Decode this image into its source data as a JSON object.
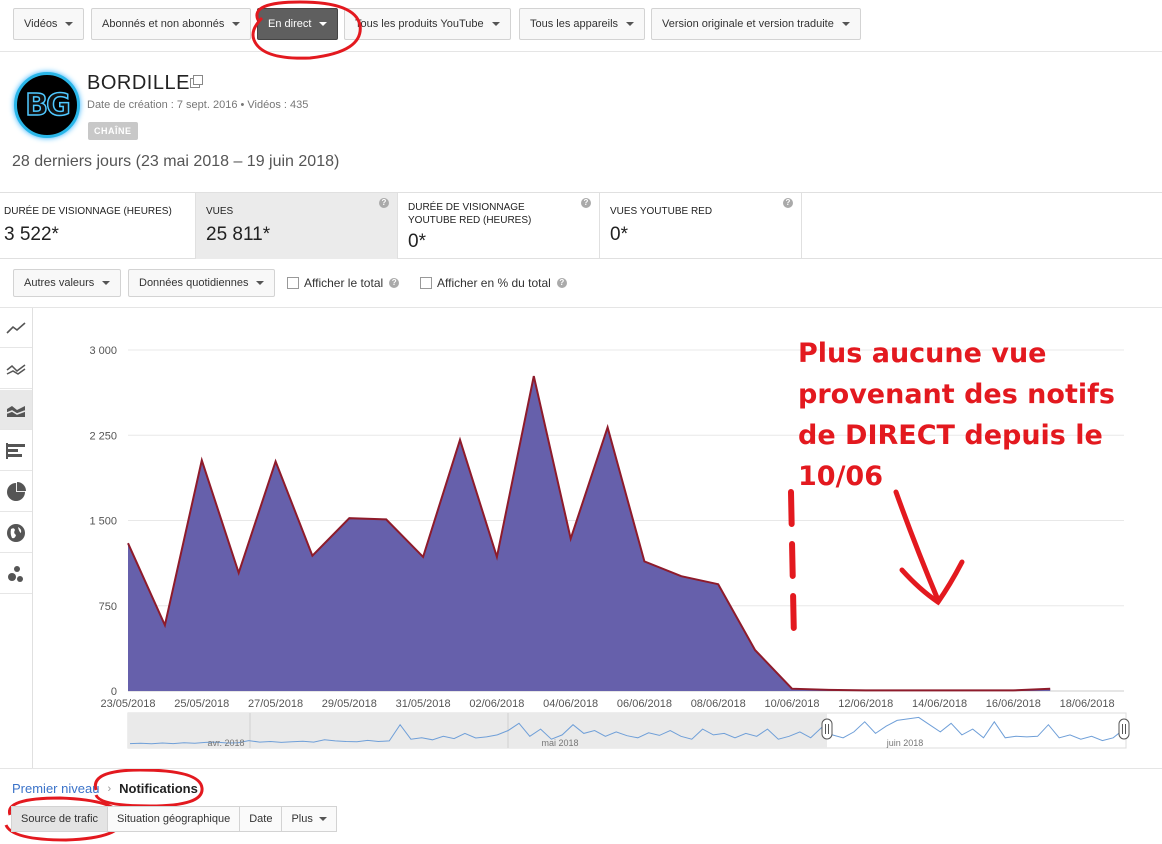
{
  "filters": [
    {
      "label": "Vidéos"
    },
    {
      "label": "Abonnés et non abonnés"
    },
    {
      "label": "En direct"
    },
    {
      "label": "Tous les produits YouTube"
    },
    {
      "label": "Tous les appareils"
    },
    {
      "label": "Version originale et version traduite"
    }
  ],
  "channel": {
    "logo_text": "BG",
    "name": "BORDILLE",
    "meta": "Date de création : 7 sept. 2016  •  Vidéos : 435",
    "badge": "CHAÎNE",
    "date_range": "28 derniers jours (23 mai 2018 – 19 juin 2018)"
  },
  "metrics": [
    {
      "label": "DURÉE DE VISIONNAGE (HEURES)",
      "value": "3 522*"
    },
    {
      "label": "VUES",
      "value": "25 811*"
    },
    {
      "label": "DURÉE DE VISIONNAGE YOUTUBE RED (HEURES)",
      "value": "0*"
    },
    {
      "label": "VUES YOUTUBE RED",
      "value": "0*"
    }
  ],
  "help_glyph": "?",
  "controls": {
    "values_dropdown": "Autres valeurs",
    "granularity_dropdown": "Données quotidiennes",
    "show_total": "Afficher le total",
    "show_percent": "Afficher en % du total"
  },
  "chart_data": {
    "type": "area",
    "y_ticks": [
      "3 000",
      "2 250",
      "1 500",
      "750",
      "0"
    ],
    "ylim": [
      0,
      3000
    ],
    "grid": true,
    "x_tick_labels": [
      "23/05/2018",
      "25/05/2018",
      "27/05/2018",
      "29/05/2018",
      "31/05/2018",
      "02/06/2018",
      "04/06/2018",
      "06/06/2018",
      "08/06/2018",
      "10/06/2018",
      "12/06/2018",
      "14/06/2018",
      "16/06/2018",
      "18/06/2018"
    ],
    "x": [
      "23/05/2018",
      "24/05/2018",
      "25/05/2018",
      "26/05/2018",
      "27/05/2018",
      "28/05/2018",
      "29/05/2018",
      "30/05/2018",
      "31/05/2018",
      "01/06/2018",
      "02/06/2018",
      "03/06/2018",
      "04/06/2018",
      "05/06/2018",
      "06/06/2018",
      "07/06/2018",
      "08/06/2018",
      "09/06/2018",
      "10/06/2018",
      "11/06/2018",
      "12/06/2018",
      "13/06/2018",
      "14/06/2018",
      "15/06/2018",
      "16/06/2018",
      "17/06/2018"
    ],
    "values": [
      1300,
      580,
      2030,
      1040,
      2020,
      1190,
      1520,
      1510,
      1180,
      2210,
      1180,
      2770,
      1340,
      2320,
      1140,
      1010,
      940,
      360,
      20,
      10,
      5,
      5,
      5,
      5,
      5,
      20
    ],
    "fill_color": "#6660ab",
    "line_color": "#8e1b2b",
    "navigator": {
      "months": [
        "avr. 2018",
        "mai 2018",
        "juin 2018"
      ],
      "values": [
        0.05,
        0.06,
        0.04,
        0.07,
        0.05,
        0.08,
        0.06,
        0.09,
        0.1,
        0.07,
        0.08,
        0.15,
        0.1,
        0.12,
        0.09,
        0.11,
        0.13,
        0.1,
        0.18,
        0.14,
        0.12,
        0.11,
        0.16,
        0.12,
        0.14,
        0.7,
        0.2,
        0.25,
        0.18,
        0.3,
        0.22,
        0.4,
        0.24,
        0.28,
        0.35,
        0.5,
        0.75,
        0.3,
        0.55,
        0.2,
        0.35,
        0.7,
        0.4,
        0.5,
        0.3,
        0.45,
        0.32,
        0.25,
        0.42,
        0.33,
        0.5,
        0.3,
        0.2,
        0.55,
        0.35,
        0.4,
        0.25,
        0.4,
        0.3,
        0.55,
        0.2,
        0.3,
        0.45,
        0.25,
        0.6,
        0.35,
        0.25,
        0.45,
        0.8,
        0.4,
        0.65,
        0.85,
        0.9,
        0.95,
        0.7,
        0.45,
        0.75,
        0.35,
        0.55,
        0.25,
        0.8,
        0.25,
        0.3,
        0.28,
        0.3,
        0.7,
        0.25,
        0.35,
        0.2,
        0.3,
        0.15,
        0.25,
        0.55
      ]
    }
  },
  "annotation": "Plus aucune vue provenant des notifs de DIRECT depuis le 10/06",
  "breadcrumb": {
    "root": "Premier niveau",
    "sep": "›",
    "current": "Notifications"
  },
  "tabs": [
    {
      "label": "Source de trafic"
    },
    {
      "label": "Situation géographique"
    },
    {
      "label": "Date"
    },
    {
      "label": "Plus"
    }
  ],
  "colors": {
    "accent_red": "#e3191f",
    "link": "#3b73c9",
    "area": "#6660ab"
  }
}
